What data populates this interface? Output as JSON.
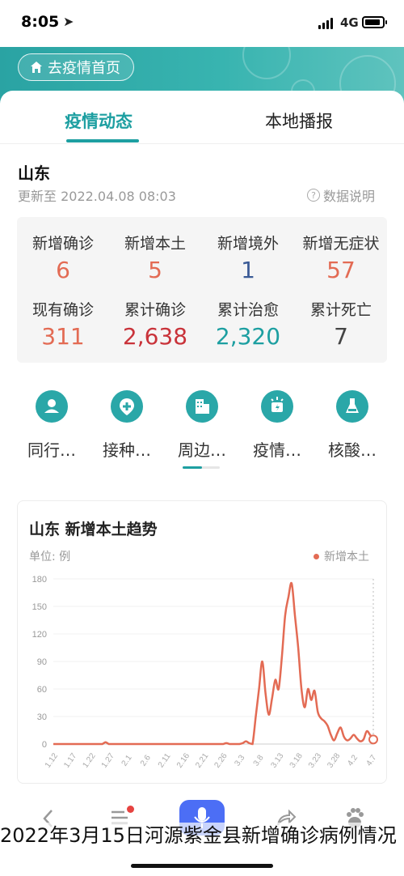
{
  "status_bar": {
    "time": "8:05",
    "network": "4G"
  },
  "header": {
    "home_button": "去疫情首页"
  },
  "tabs": [
    {
      "label": "疫情动态",
      "active": true
    },
    {
      "label": "本地播报",
      "active": false
    }
  ],
  "region": {
    "name": "山东",
    "updated": "更新至 2022.04.08 08:03",
    "data_note": "数据说明"
  },
  "stats": [
    {
      "label": "新增确诊",
      "value": "6",
      "color": "#e36b54"
    },
    {
      "label": "新增本土",
      "value": "5",
      "color": "#e36b54"
    },
    {
      "label": "新增境外",
      "value": "1",
      "color": "#3a5a96"
    },
    {
      "label": "新增无症状",
      "value": "57",
      "color": "#e36b54"
    },
    {
      "label": "现有确诊",
      "value": "311",
      "color": "#e36b54"
    },
    {
      "label": "累计确诊",
      "value": "2,638",
      "color": "#c9333a"
    },
    {
      "label": "累计治愈",
      "value": "2,320",
      "color": "#1d9fa1"
    },
    {
      "label": "累计死亡",
      "value": "7",
      "color": "#444444"
    }
  ],
  "services": [
    {
      "label": "同行…",
      "icon": "person-icon"
    },
    {
      "label": "接种…",
      "icon": "medical-cross-icon"
    },
    {
      "label": "周边…",
      "icon": "building-icon"
    },
    {
      "label": "疫情…",
      "icon": "alert-icon"
    },
    {
      "label": "核酸…",
      "icon": "flask-icon"
    }
  ],
  "chart": {
    "title": "山东  新增本土趋势",
    "unit": "单位: 例",
    "legend": "新增本土"
  },
  "chart_data": {
    "type": "line",
    "title": "山东  新增本土趋势",
    "ylabel": "单位: 例",
    "ylim": [
      0,
      180
    ],
    "yticks": [
      0,
      30,
      60,
      90,
      120,
      150,
      180
    ],
    "xticks": [
      "1.12",
      "1.17",
      "1.22",
      "1.27",
      "2.1",
      "2.6",
      "2.11",
      "2.16",
      "2.21",
      "2.26",
      "3.3",
      "3.8",
      "3.13",
      "3.18",
      "3.23",
      "3.28",
      "4.2",
      "4.7"
    ],
    "grid": true,
    "series": [
      {
        "name": "新增本土",
        "color": "#e36b54",
        "values": [
          0,
          0,
          0,
          0,
          0,
          0,
          0,
          0,
          0,
          0,
          0,
          0,
          0,
          0,
          0,
          0,
          2,
          0,
          0,
          0,
          0,
          0,
          0,
          0,
          0,
          0,
          0,
          0,
          0,
          0,
          0,
          0,
          0,
          0,
          0,
          0,
          0,
          0,
          0,
          0,
          0,
          0,
          0,
          0,
          0,
          0,
          0,
          0,
          0,
          0,
          0,
          0,
          0,
          1,
          0,
          0,
          0,
          0,
          1,
          3,
          1,
          0,
          30,
          60,
          90,
          55,
          32,
          50,
          70,
          60,
          95,
          140,
          160,
          175,
          140,
          105,
          60,
          40,
          60,
          48,
          58,
          35,
          28,
          25,
          20,
          10,
          4,
          12,
          18,
          8,
          4,
          6,
          10,
          6,
          3,
          5,
          14,
          10,
          5
        ]
      }
    ],
    "x_start": "1.12",
    "x_end": "4.7",
    "last_value": 5
  },
  "bottom_nav": [
    {
      "name": "back",
      "icon": "chevron-left-icon"
    },
    {
      "name": "menu",
      "icon": "menu-icon"
    },
    {
      "name": "voice",
      "icon": "mic-icon"
    },
    {
      "name": "share",
      "icon": "share-icon"
    },
    {
      "name": "baidu",
      "icon": "baidu-paw-icon"
    }
  ],
  "caption": "2022年3月15日河源紫金县新增确诊病例情况"
}
